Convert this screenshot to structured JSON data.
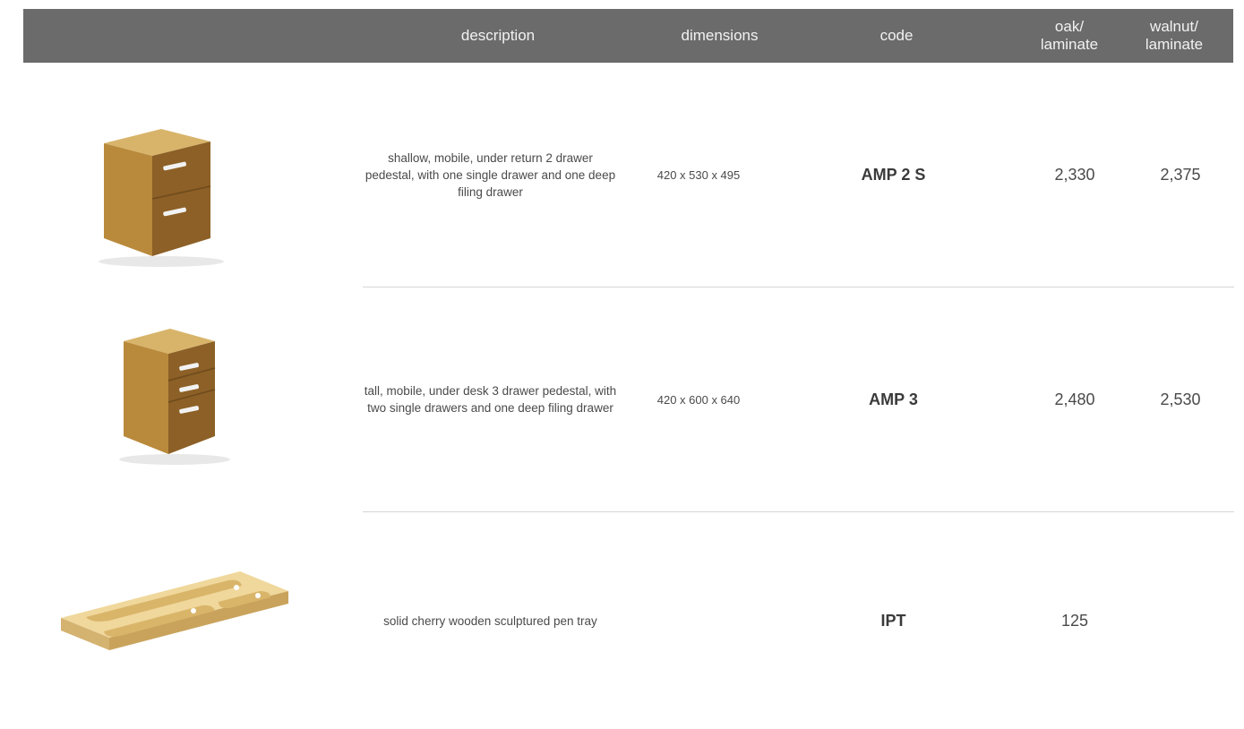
{
  "header": {
    "description": "description",
    "dimensions": "dimensions",
    "code": "code",
    "oak_laminate": "oak/\nlaminate",
    "walnut_laminate": "walnut/\nlaminate"
  },
  "rows": [
    {
      "image_icon": "pedestal-2-drawer-icon",
      "description": "shallow, mobile, under return 2 drawer pedestal, with one single drawer and one deep filing drawer",
      "dimensions": "420 x 530 x 495",
      "code": "AMP 2 S",
      "oak": "2,330",
      "walnut": "2,375"
    },
    {
      "image_icon": "pedestal-3-drawer-icon",
      "description": "tall, mobile, under desk 3 drawer pedestal, with two single drawers and one deep filing drawer",
      "dimensions": "420 x 600 x 640",
      "code": "AMP 3",
      "oak": "2,480",
      "walnut": "2,530"
    },
    {
      "image_icon": "pen-tray-icon",
      "description": "solid cherry wooden sculptured pen tray",
      "dimensions": "",
      "code": "IPT",
      "oak": "125",
      "walnut": ""
    }
  ],
  "colors": {
    "header_bg": "#6b6b6b",
    "wood_light": "#c9a24f",
    "wood_dark": "#8a5f2a"
  }
}
